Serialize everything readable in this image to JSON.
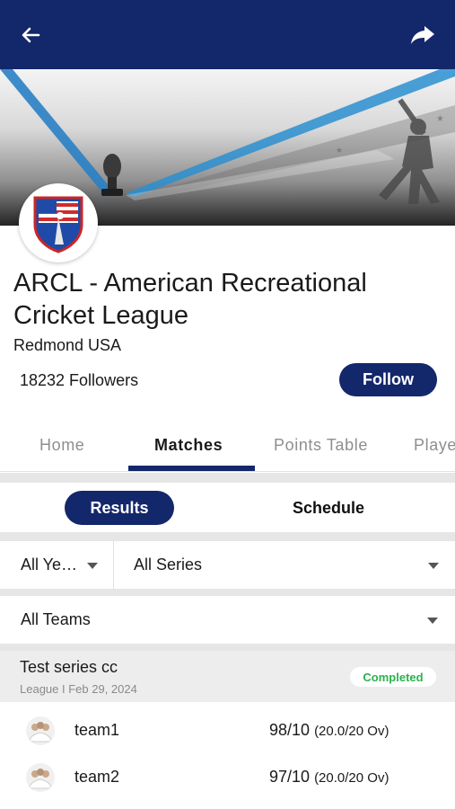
{
  "header": {
    "back_icon": "arrow-left-icon",
    "share_icon": "share-arrow-icon",
    "bg_color": "#13276b"
  },
  "league": {
    "name": "ARCL - American Recreational Cricket League",
    "location": "Redmond USA",
    "followers": "18232 Followers",
    "follow_label": "Follow"
  },
  "tabs": [
    {
      "label": "Home",
      "active": false
    },
    {
      "label": "Matches",
      "active": true
    },
    {
      "label": "Points Table",
      "active": false
    },
    {
      "label": "Players",
      "active": false
    }
  ],
  "segments": {
    "results_label": "Results",
    "schedule_label": "Schedule",
    "selected": "Results"
  },
  "filters": {
    "year": "All Ye…",
    "series": "All Series",
    "teams": "All Teams"
  },
  "match": {
    "series_title": "Test series cc",
    "meta": "League I Feb 29, 2024",
    "status": "Completed",
    "status_color": "#2bb24c",
    "teams": [
      {
        "name": "team1",
        "score": "98/10",
        "overs": "(20.0/20 Ov)"
      },
      {
        "name": "team2",
        "score": "97/10",
        "overs": "(20.0/20 Ov)"
      }
    ]
  }
}
